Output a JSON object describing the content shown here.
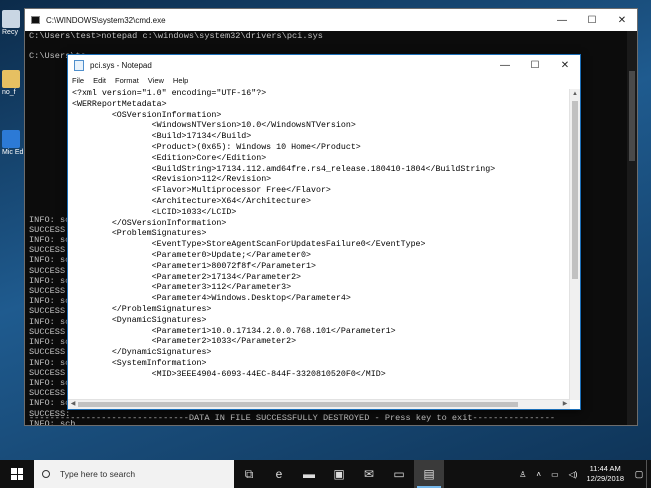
{
  "colors": {
    "desktop": "#1f5b8f",
    "cmd_bg": "#0c0c0c",
    "cmd_text": "#c0c0c0",
    "notepad_border": "#1c6fb8",
    "taskbar": "#101010",
    "active_indicator": "#76b9ed"
  },
  "desktop": {
    "icons": [
      {
        "label": "Recy",
        "icon": "recycle-bin-icon"
      },
      {
        "label": "no_f",
        "icon": "folder-icon"
      },
      {
        "label": "Mic Ed",
        "icon": "edge-shortcut-icon"
      }
    ]
  },
  "cmd": {
    "title": "C:\\WINDOWS\\system32\\cmd.exe",
    "lines": [
      "C:\\Users\\test>notepad c:\\windows\\system32\\drivers\\pci.sys",
      "",
      "C:\\Users\\te",
      "",
      "",
      "",
      "",
      "",
      "",
      "",
      "",
      "",
      "",
      "",
      "",
      "",
      "",
      "",
      "INFO: sch",
      "SUCCESS:",
      "INFO: sch",
      "SUCCESS:",
      "INFO: sch",
      "SUCCESS:",
      "INFO: sch",
      "SUCCESS:",
      "INFO: sch",
      "SUCCESS:",
      "INFO: sch",
      "SUCCESS:",
      "INFO: sch",
      "SUCCESS:",
      "INFO: sch",
      "SUCCESS:",
      "INFO: sch",
      "SUCCESS:",
      "INFO: sch",
      "SUCCESS:",
      "INFO: sch",
      "SUCCESS:",
      "INFO: sch",
      "SUCCESS:"
    ],
    "footer": "-------------------------------DATA IN FILE SUCCESSFULLY DESTROYED - Press key to exit----------------"
  },
  "notepad": {
    "title": "pci.sys - Notepad",
    "menu": [
      "File",
      "Edit",
      "Format",
      "View",
      "Help"
    ],
    "lines": [
      "<?xml version=\"1.0\" encoding=\"UTF-16\"?>",
      "<WERReportMetadata>",
      "        <OSVersionInformation>",
      "                <WindowsNTVersion>10.0</WindowsNTVersion>",
      "                <Build>17134</Build>",
      "                <Product>(0x65): Windows 10 Home</Product>",
      "                <Edition>Core</Edition>",
      "                <BuildString>17134.112.amd64fre.rs4_release.180410-1804</BuildString>",
      "                <Revision>112</Revision>",
      "                <Flavor>Multiprocessor Free</Flavor>",
      "                <Architecture>X64</Architecture>",
      "                <LCID>1033</LCID>",
      "        </OSVersionInformation>",
      "        <ProblemSignatures>",
      "                <EventType>StoreAgentScanForUpdatesFailure0</EventType>",
      "                <Parameter0>Update;</Parameter0>",
      "                <Parameter1>80072f8f</Parameter1>",
      "                <Parameter2>17134</Parameter2>",
      "                <Parameter3>112</Parameter3>",
      "                <Parameter4>Windows.Desktop</Parameter4>",
      "        </ProblemSignatures>",
      "        <DynamicSignatures>",
      "                <Parameter1>10.0.17134.2.0.0.768.101</Parameter1>",
      "                <Parameter2>1033</Parameter2>",
      "        </DynamicSignatures>",
      "        <SystemInformation>",
      "                <MID>3EEE4904-6093-44EC-844F-3320810520F0</MID>"
    ]
  },
  "window_controls": {
    "minimize": "—",
    "maximize": "☐",
    "close": "✕"
  },
  "taskbar": {
    "search_placeholder": "Type here to search",
    "apps": [
      {
        "name": "task-view-icon",
        "glyph": "⧉"
      },
      {
        "name": "edge-icon",
        "glyph": "e"
      },
      {
        "name": "file-explorer-icon",
        "glyph": "▬"
      },
      {
        "name": "store-icon",
        "glyph": "▣"
      },
      {
        "name": "mail-icon",
        "glyph": "✉"
      },
      {
        "name": "cmd-icon",
        "glyph": "▭"
      },
      {
        "name": "notepad-icon",
        "glyph": "▤"
      }
    ],
    "time": "11:44 AM",
    "date": "12/29/2018"
  }
}
